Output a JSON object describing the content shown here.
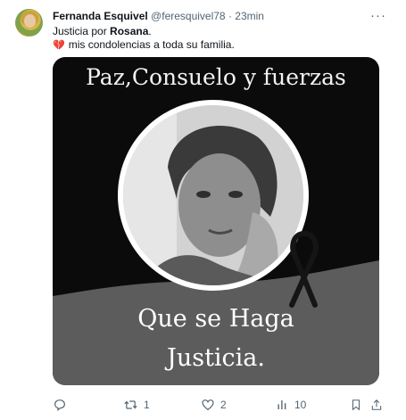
{
  "tweet": {
    "author_name": "Fernanda Esquivel",
    "handle": "@feresquivel78",
    "separator": "·",
    "time": "23min",
    "more": "···",
    "text_prefix": "Justicia por ",
    "text_bold": "Rosana",
    "text_suffix": ".",
    "line2_emoji": "💔",
    "line2_text": "mis condolencias a toda su familia."
  },
  "media": {
    "top_text": "Paz,Consuelo y fuerzas",
    "bottom_line1": "Que se Haga",
    "bottom_line2": "Justicia."
  },
  "actions": {
    "replies": "",
    "retweets": "1",
    "likes": "2",
    "views": "10"
  },
  "icons": [
    "reply-icon",
    "retweet-icon",
    "like-icon",
    "views-icon",
    "bookmark-icon",
    "share-icon"
  ],
  "colors": {
    "secondary_text": "#536471",
    "primary_text": "#0f1419"
  }
}
